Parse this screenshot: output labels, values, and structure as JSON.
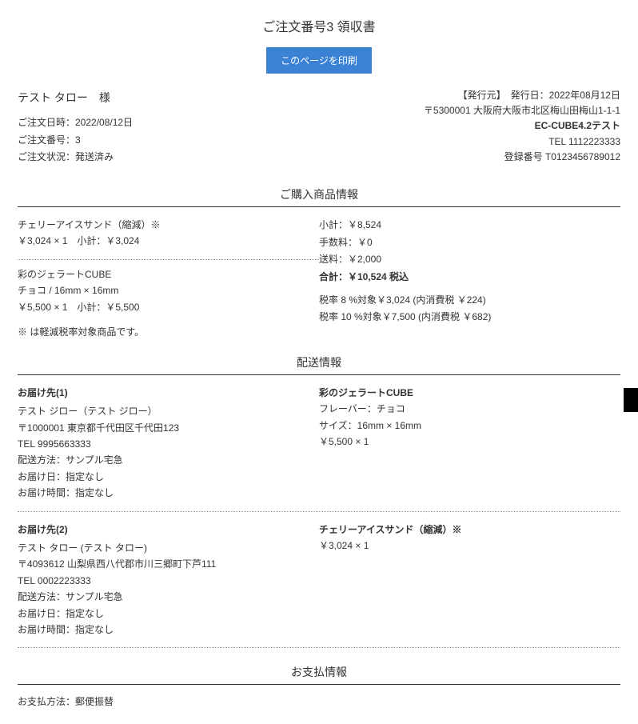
{
  "title": "ご注文番号3 領収書",
  "print_button": "このページを印刷",
  "customer_name": "テスト タロー　様",
  "order": {
    "datetime_label": "ご注文日時：2022/08/12日",
    "number_label": "ご注文番号：3",
    "status_label": "ご注文状況：発送済み"
  },
  "company": {
    "issued": "【発行元】　発行日：2022年08月12日",
    "address": "〒5300001 大阪府大阪市北区梅山田梅山1-1-1",
    "name": "EC-CUBE4.2テスト",
    "tel": "TEL 1112223333",
    "reg": "登録番号 T0123456789012"
  },
  "sections": {
    "purchase": "ご購入商品情報",
    "delivery": "配送情報",
    "payment": "お支払情報"
  },
  "items": [
    {
      "name": "チェリーアイスサンド（縮減）※",
      "price_line": "￥3,024 × 1　小計：￥3,024"
    },
    {
      "name": "彩のジェラートCUBE",
      "spec": "チョコ / 16mm × 16mm",
      "price_line": "￥5,500 × 1　小計：￥5,500"
    }
  ],
  "item_note": "※ は軽減税率対象商品です。",
  "totals": {
    "subtotal": "小計：￥8,524",
    "fee": "手数料：￥0",
    "shipping": "送料：￥2,000",
    "total": "合計：￥10,524 税込"
  },
  "tax": {
    "t8": "税率 8 %対象￥3,024 (内消費税 ￥224)",
    "t10": "税率 10 %対象￥7,500 (内消費税 ￥682)"
  },
  "deliveries": [
    {
      "title": "お届け先(1)",
      "name": "テスト ジロー（テスト ジロー）",
      "addr": "〒1000001 東京都千代田区千代田123",
      "tel": "TEL 9995663333",
      "method": "配送方法：サンプル宅急",
      "date": "お届け日：指定なし",
      "time": "お届け時間：指定なし",
      "product_name": "彩のジェラートCUBE",
      "product_spec1": "フレーバー：チョコ",
      "product_spec2": "サイズ：16mm × 16mm",
      "product_price": "￥5,500 × 1"
    },
    {
      "title": "お届け先(2)",
      "name": "テスト タロー (テスト タロー)",
      "addr": "〒4093612 山梨県西八代郡市川三郷町下芦111",
      "tel": "TEL 0002223333",
      "method": "配送方法：サンプル宅急",
      "date": "お届け日：指定なし",
      "time": "お届け時間：指定なし",
      "product_name": "チェリーアイスサンド（縮減）※",
      "product_price": "￥3,024 × 1"
    }
  ],
  "payment_method": "お支払方法：郵便振替"
}
